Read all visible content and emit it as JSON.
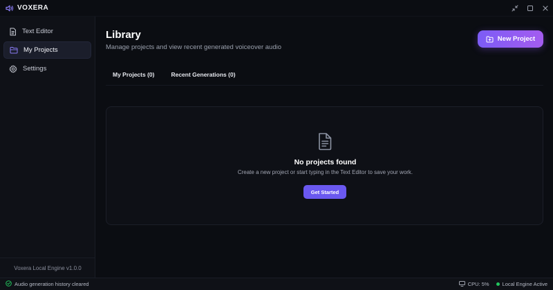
{
  "app": {
    "name": "VOXERA",
    "accent": "#7c5cf5"
  },
  "window_controls": [
    "shrink-icon",
    "maximize-icon",
    "close-icon"
  ],
  "sidebar": {
    "items": [
      {
        "label": "Text Editor",
        "icon": "document-icon",
        "active": false
      },
      {
        "label": "My Projects",
        "icon": "folder-icon",
        "active": true
      },
      {
        "label": "Settings",
        "icon": "gear-icon",
        "active": false
      }
    ],
    "footer": "Voxera Local Engine v1.0.0"
  },
  "main": {
    "title": "Library",
    "subtitle": "Manage projects and view recent generated voiceover audio",
    "new_project_label": "New Project",
    "tabs": [
      {
        "label": "My Projects (0)"
      },
      {
        "label": "Recent Generations (0)"
      }
    ],
    "empty_state": {
      "icon": "document-icon",
      "title": "No projects found",
      "description": "Create a new project or start typing in the Text Editor to save your work.",
      "button_label": "Get Started"
    }
  },
  "statusbar": {
    "message": "Audio generation history cleared",
    "cpu": "CPU: 5%",
    "engine": "Local Engine Active",
    "engine_color": "#22c55e"
  }
}
